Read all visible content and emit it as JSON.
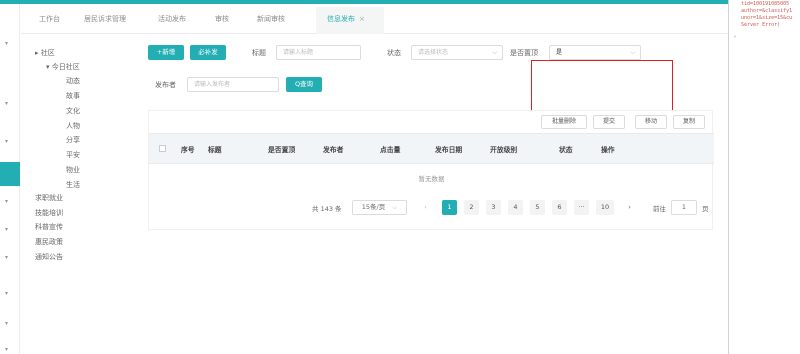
{
  "tabs": [
    {
      "label": "工作台"
    },
    {
      "label": "居民诉求管理"
    },
    {
      "label": "活动发布"
    },
    {
      "label": "审核"
    },
    {
      "label": "新闻审核"
    },
    {
      "label": "信息发布",
      "close": "×"
    }
  ],
  "tree": {
    "root": "社区",
    "child": "今日社区",
    "leaves": [
      "动态",
      "故事",
      "文化",
      "人物",
      "分享",
      "平安",
      "物业",
      "生活"
    ],
    "others": [
      "求职就业",
      "技能培训",
      "科普宣传",
      "惠民政策",
      "通知公告"
    ]
  },
  "filters": {
    "add_label": "+新增",
    "supplement_label": "必补发",
    "title_label": "标题",
    "title_placeholder": "请输入标题",
    "status_label": "状态",
    "status_placeholder": "请选择状态",
    "pinned_label": "是否置顶",
    "pinned_value": "是",
    "publisher_label": "发布者",
    "publisher_placeholder": "请输入发布者",
    "query_label": "Q查询"
  },
  "toolbar": {
    "batch_delete": "批量删除",
    "submit": "提交",
    "move": "移动",
    "copy": "复制"
  },
  "table": {
    "columns": [
      "序号",
      "标题",
      "是否置顶",
      "发布者",
      "点击量",
      "发布日期",
      "开放级别",
      "状态",
      "操作"
    ],
    "empty_text": "暂无数据"
  },
  "pagination": {
    "total": "共 143 条",
    "page_size": "15条/页",
    "prev": "‹",
    "pages": [
      "1",
      "2",
      "3",
      "4",
      "5",
      "6",
      "···",
      "10"
    ],
    "next": "›",
    "goto_label": "前往",
    "goto_value": "1",
    "page_unit": "页"
  },
  "devtools": {
    "lines": [
      "tid=100191085005",
      "author=&classify1",
      "unor=1&size=15&cu",
      "Server Error)"
    ],
    "caret": "›"
  },
  "colors": {
    "accent": "#23aeb3",
    "highlight": "#e02020"
  }
}
